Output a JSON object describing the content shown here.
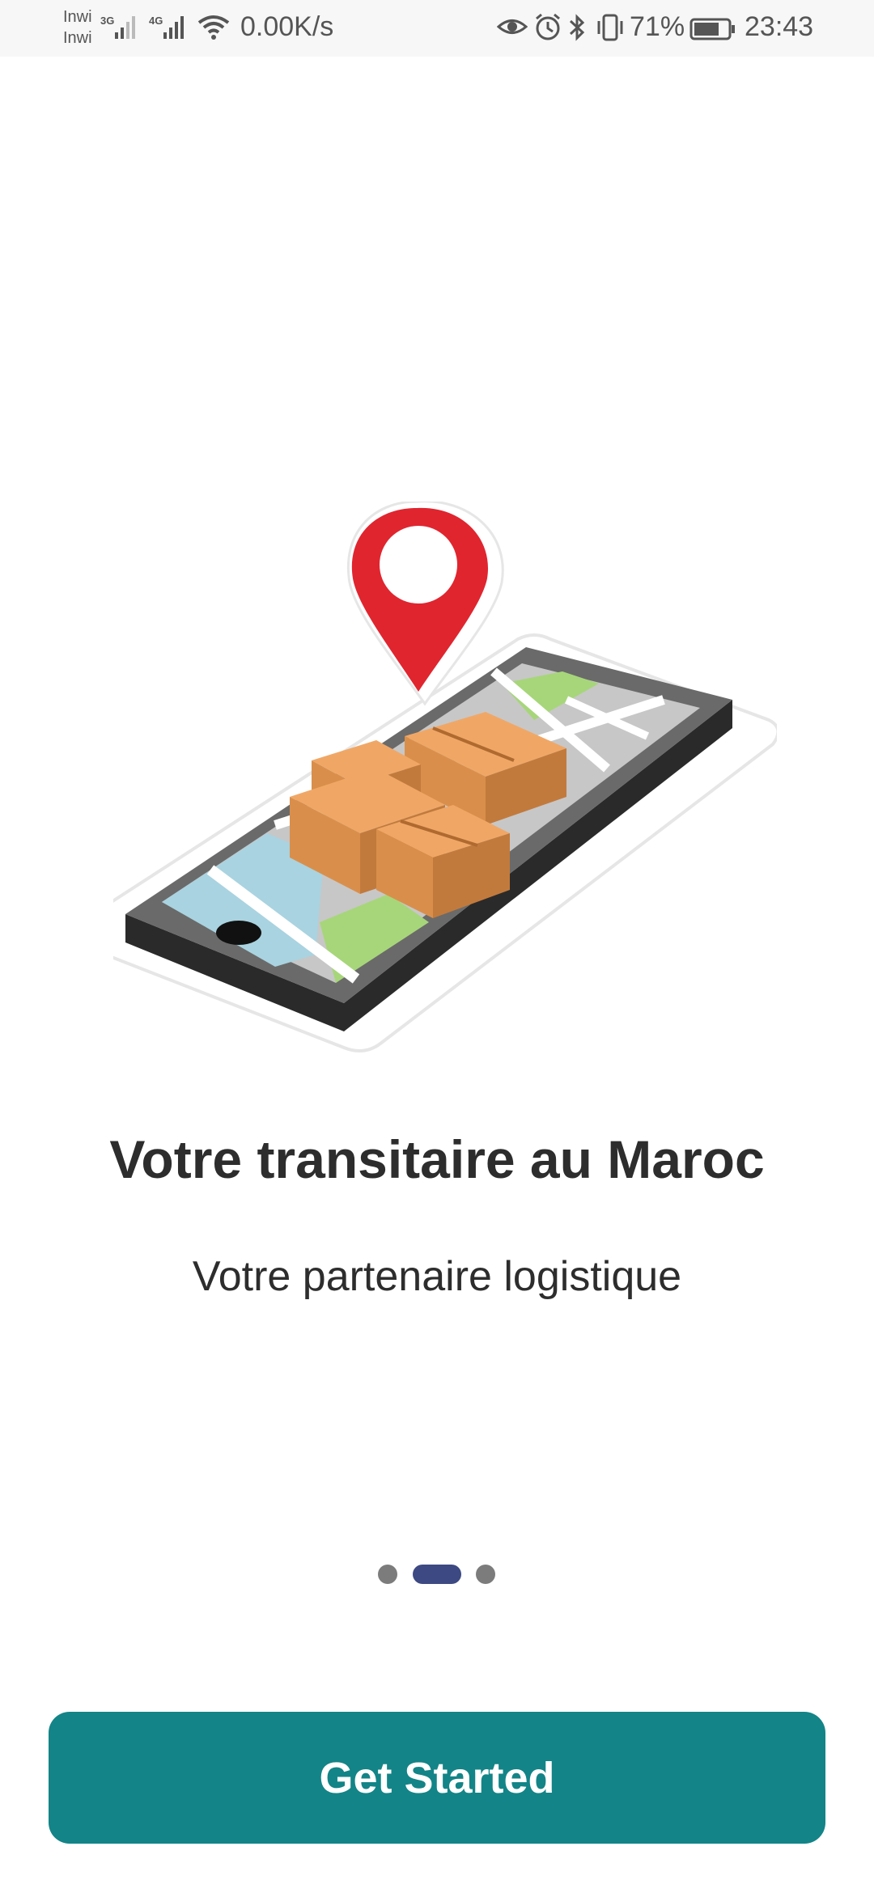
{
  "status_bar": {
    "carrier_1": "Inwi",
    "carrier_2": "Inwi",
    "network_1": "3G",
    "network_2": "4G",
    "speed": "0.00K/s",
    "battery": "71%",
    "time": "23:43",
    "icons": [
      "signal-icon",
      "wifi-icon",
      "eye-icon",
      "alarm-icon",
      "bluetooth-icon",
      "vibrate-icon",
      "battery-icon"
    ]
  },
  "onboarding": {
    "illustration": "phone-map-delivery-illustration",
    "title": "Votre transitaire au Maroc",
    "subtitle": "Votre partenaire logistique",
    "pager": {
      "pages": 3,
      "active_index": 1,
      "active_color": "#3d4982",
      "inactive_color": "#7c7c7c"
    },
    "cta_label": "Get Started",
    "cta_color": "#138487"
  }
}
